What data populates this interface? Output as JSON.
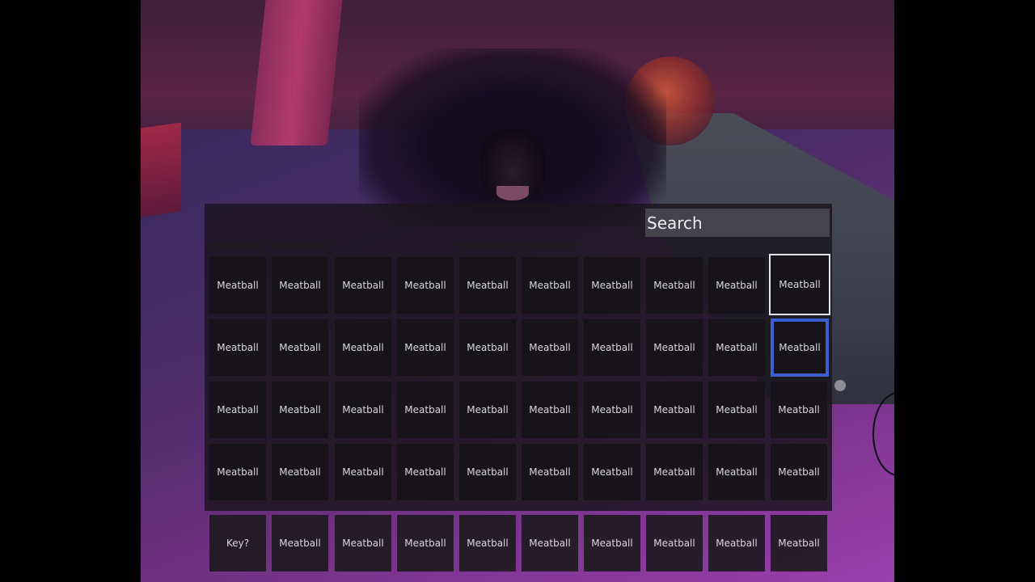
{
  "search": {
    "placeholder": "Search"
  },
  "inventory": {
    "rows": [
      [
        "Meatball",
        "Meatball",
        "Meatball",
        "Meatball",
        "Meatball",
        "Meatball",
        "Meatball",
        "Meatball",
        "Meatball",
        "Meatball"
      ],
      [
        "Meatball",
        "Meatball",
        "Meatball",
        "Meatball",
        "Meatball",
        "Meatball",
        "Meatball",
        "Meatball",
        "Meatball",
        "Meatball"
      ],
      [
        "Meatball",
        "Meatball",
        "Meatball",
        "Meatball",
        "Meatball",
        "Meatball",
        "Meatball",
        "Meatball",
        "Meatball",
        "Meatball"
      ],
      [
        "Meatball",
        "Meatball",
        "Meatball",
        "Meatball",
        "Meatball",
        "Meatball",
        "Meatball",
        "Meatball",
        "Meatball",
        "Meatball"
      ]
    ],
    "selected_outline_color": "#e4e4e8",
    "focused_outline_color": "#3b5fd1"
  },
  "hotbar": {
    "slots": [
      "Key?",
      "Meatball",
      "Meatball",
      "Meatball",
      "Meatball",
      "Meatball",
      "Meatball",
      "Meatball",
      "Meatball",
      "Meatball"
    ]
  },
  "scene": {
    "creature": "dark-winged-creature",
    "orb_color": "#d05a3a"
  }
}
